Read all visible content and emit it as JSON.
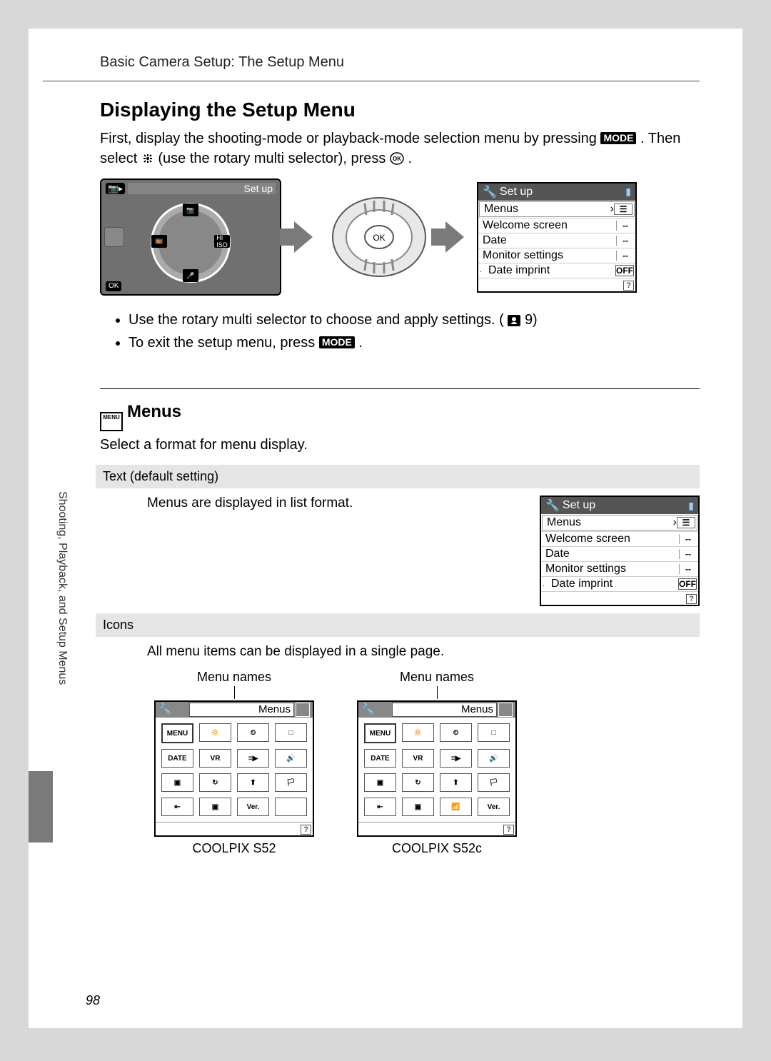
{
  "breadcrumb": "Basic Camera Setup: The Setup Menu",
  "heading": "Displaying the Setup Menu",
  "intro_1": "First, display the shooting-mode or playback-mode selection menu by pressing ",
  "mode_label": "MODE",
  "intro_2": ". Then select ",
  "intro_3": " (use the rotary multi selector), press ",
  "ok_label": "OK",
  "intro_4": ".",
  "cam_title": "Set up",
  "selector_ok": "OK",
  "setup_menu_title": "Set up",
  "setup_rows": [
    {
      "label": "Menus",
      "ind": ""
    },
    {
      "label": "Welcome screen",
      "ind": "--"
    },
    {
      "label": "Date",
      "ind": "--"
    },
    {
      "label": "Monitor settings",
      "ind": "--"
    },
    {
      "label": "Date imprint",
      "ind": "OFF"
    }
  ],
  "bullets": [
    "Use the rotary multi selector to choose and apply settings. (",
    "To exit the setup menu, press "
  ],
  "bullet_ref": " 9)",
  "bullet_end": ".",
  "menus_heading": "Menus",
  "menus_prefix": "MENU",
  "menus_sub": "Select a format for menu display.",
  "opt_text_label": "Text (default setting)",
  "opt_text_desc": "Menus are displayed in list format.",
  "opt_icons_label": "Icons",
  "opt_icons_desc": "All menu items can be displayed in a single page.",
  "menu_names_caption": "Menu names",
  "grid_header": "Menus",
  "model_a": "COOLPIX S52",
  "model_b": "COOLPIX S52c",
  "grid_cells_a": [
    "MENU",
    "🔅",
    "⏲",
    "□",
    "DATE",
    "VR",
    "≡▶",
    "🔊",
    "▣",
    "↻",
    "⬆",
    "🏳",
    "⇤",
    "▣",
    "Ver.",
    ""
  ],
  "grid_cells_b": [
    "MENU",
    "🔅",
    "⏲",
    "□",
    "DATE",
    "VR",
    "≡▶",
    "🔊",
    "▣",
    "↻",
    "⬆",
    "🏳",
    "⇤",
    "▣",
    "📶",
    "Ver."
  ],
  "side_caption": "Shooting, Playback, and Setup Menus",
  "page_number": "98"
}
